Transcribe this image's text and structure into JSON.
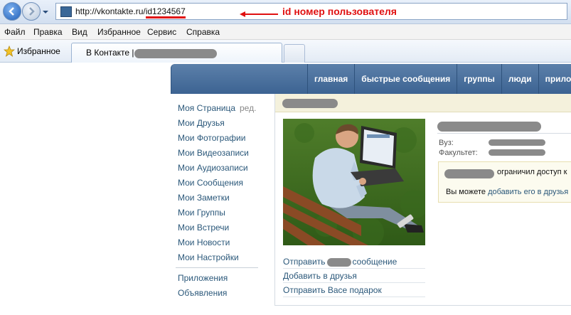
{
  "browser": {
    "url_prefix": "http://vkontakte.ru/",
    "url_id": "id1234567",
    "annotation": "id номер пользователя",
    "menu": [
      "Файл",
      "Правка",
      "Вид",
      "Избранное",
      "Сервис",
      "Справка"
    ],
    "favorites_label": "Избранное",
    "tab_title": "В Контакте |"
  },
  "colors": {
    "link": "#2b587a",
    "header": "#45688e",
    "annotation": "#e01010"
  },
  "nav": [
    "главная",
    "быстрые сообщения",
    "группы",
    "люди",
    "прилож"
  ],
  "left_menu": [
    "Моя Страница",
    "Мои Друзья",
    "Мои Фотографии",
    "Мои Видеозаписи",
    "Мои Аудиозаписи",
    "Мои Сообщения",
    "Мои Заметки",
    "Мои Группы",
    "Мои Встречи",
    "Мои Новости",
    "Мои Настройки"
  ],
  "edit_label": "ред.",
  "left_menu_extra": [
    "Приложения",
    "Объявления"
  ],
  "profile": {
    "university_label": "Вуз:",
    "faculty_label": "Факультет:"
  },
  "notice": {
    "restricted_text": "ограничил доступ к",
    "add_prefix": "Вы можете",
    "add_link": "добавить его в друзья"
  },
  "actions": {
    "send_prefix": "Отправить",
    "send_suffix": "сообщение",
    "add_friend": "Добавить в друзья",
    "send_gift": "Отправить Васе подарок"
  }
}
